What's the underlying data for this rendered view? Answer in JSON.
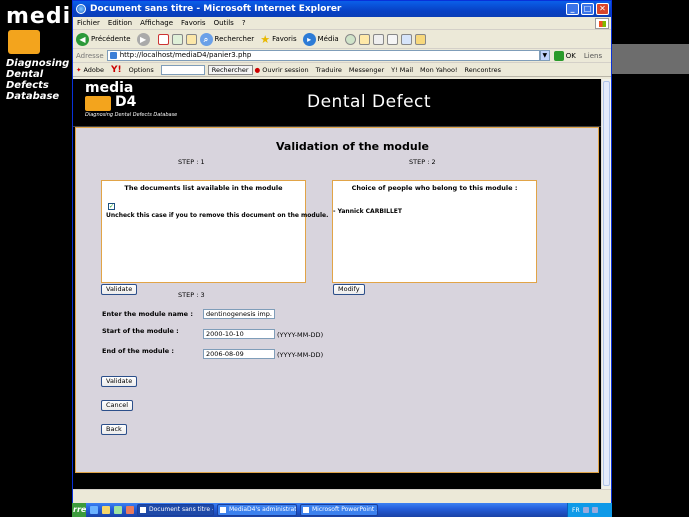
{
  "background": {
    "logo_text": "media",
    "sub": "Diagnosing Dental Defects Database"
  },
  "window": {
    "title": "Document sans titre - Microsoft Internet Explorer",
    "controls": {
      "min": "_",
      "max": "□",
      "close": "✕"
    }
  },
  "menu": [
    "Fichier",
    "Edition",
    "Affichage",
    "Favoris",
    "Outils",
    "?"
  ],
  "toolbar": {
    "back": "Précédente",
    "search": "Rechercher",
    "favorites": "Favoris",
    "media": "Média"
  },
  "addressbar": {
    "label": "Adresse",
    "url": "http://localhost/mediaD4/panier3.php",
    "go": "OK",
    "links": "Liens"
  },
  "linkbar": {
    "adobe": "Adobe",
    "options": "Options",
    "search_btn": "Rechercher",
    "session": "Ouvrir session",
    "translate": "Traduire",
    "messenger": "Messenger",
    "mail": "Y! Mail",
    "myyahoo": "Mon Yahoo!",
    "meetings": "Rencontres"
  },
  "site": {
    "logo_top": "media",
    "logo_bottom": "D4",
    "logo_sub": "Diagnosing Dental Defects Database",
    "title": "Dental Defect"
  },
  "page": {
    "heading": "Validation of the module",
    "step1": "STEP : 1",
    "step2": "STEP : 2",
    "step3": "STEP : 3",
    "docs_box": {
      "title": "The documents list available in the module",
      "checkbox_checked": "✓",
      "checkbox_label": "Uncheck this case if you to remove this document on the module."
    },
    "people_box": {
      "title": "Choice of people who belong to this module :",
      "person": "- Yannick CARBILLET"
    },
    "validate_btn_1": "Validate",
    "modify_btn": "Modify",
    "form": {
      "name_label": "Enter the module name :",
      "name_value": "dentinogenesis imp.",
      "start_label": "Start of the module :",
      "start_value": "2000-10-10",
      "end_label": "End of the module :",
      "end_value": "2006-08-09",
      "format": "(YYYY-MM-DD)"
    },
    "validate_btn_2": "Validate",
    "cancel_btn": "Cancel",
    "back_btn": "Back"
  },
  "taskbar": {
    "start": "rrer",
    "tasks": [
      "Document sans titre -...",
      "MediaD4's administrat...",
      "Microsoft PowerPoint ..."
    ],
    "tray": "FR"
  },
  "colors": {
    "accent": "#e1a447",
    "page_bg": "#d8d4dd",
    "title_blue": "#0a5fe9"
  }
}
